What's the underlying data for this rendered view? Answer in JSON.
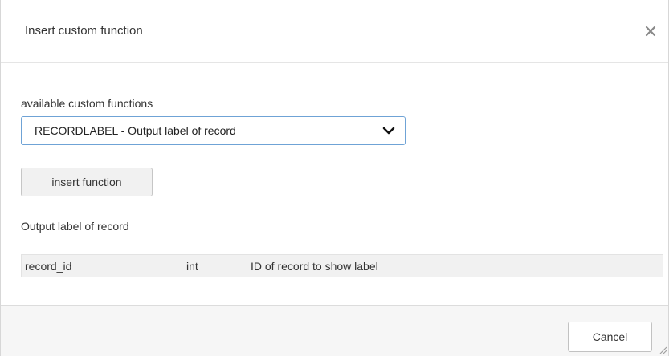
{
  "dialog": {
    "title": "Insert custom function",
    "close_icon": "close-icon"
  },
  "body": {
    "select_label": "available custom functions",
    "select_value": "RECORDLABEL - Output label of record",
    "insert_button": "insert function",
    "description": "Output label of record",
    "parameters": [
      {
        "name": "record_id",
        "type": "int",
        "description": "ID of record to show label"
      }
    ]
  },
  "footer": {
    "cancel_button": "Cancel"
  },
  "colors": {
    "select_border": "#6fa3d6",
    "footer_bg": "#f6f6f6",
    "table_bg": "#f1f1f1"
  }
}
